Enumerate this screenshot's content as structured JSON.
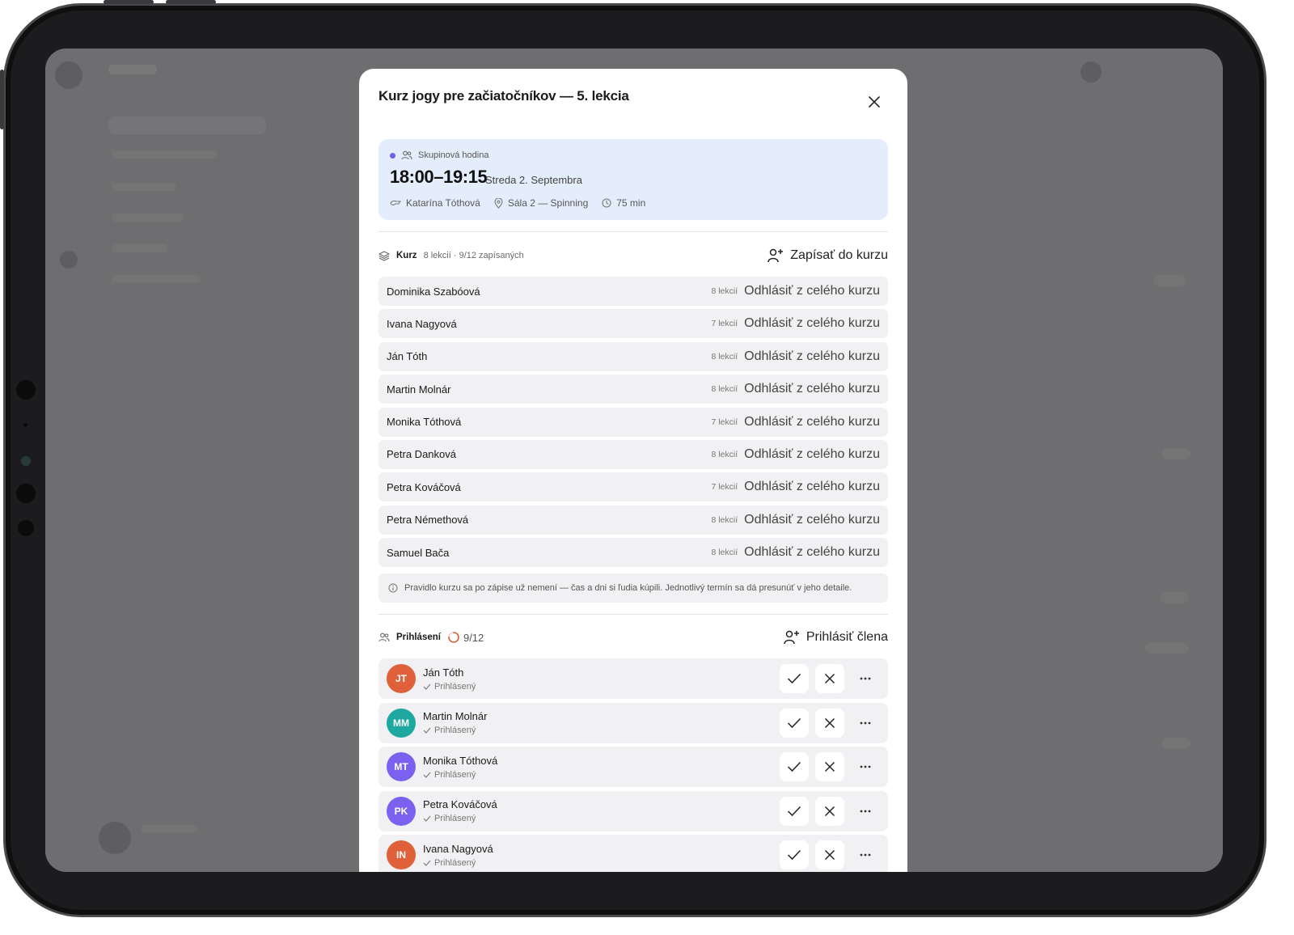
{
  "modal": {
    "title": "Kurz jogy pre začiatočníkov — 5. lekcia"
  },
  "event": {
    "type_label": "Skupinová hodina",
    "time": "18:00–19:15",
    "date": "Streda 2. Septembra",
    "instructor": "Katarína Tóthová",
    "room": "Sála 2 — Spinning",
    "duration": "75 min",
    "dot_color": "#6b63e8"
  },
  "course": {
    "label": "Kurz",
    "meta": "8 lekcií · 9/12 zapísaných",
    "enroll_label": "Zapísať do kurzu",
    "unenroll_label": "Odhlásiť z celého kurzu",
    "participants": [
      {
        "name": "Dominika Szabóová",
        "lessons": "8 lekcií"
      },
      {
        "name": "Ivana Nagyová",
        "lessons": "7 lekcií"
      },
      {
        "name": "Ján Tóth",
        "lessons": "8 lekcií"
      },
      {
        "name": "Martin Molnár",
        "lessons": "8 lekcií"
      },
      {
        "name": "Monika Tóthová",
        "lessons": "7 lekcií"
      },
      {
        "name": "Petra Danková",
        "lessons": "8 lekcií"
      },
      {
        "name": "Petra Kováčová",
        "lessons": "7 lekcií"
      },
      {
        "name": "Petra Némethová",
        "lessons": "8 lekcií"
      },
      {
        "name": "Samuel Bača",
        "lessons": "8 lekcií"
      }
    ],
    "note": "Pravidlo kurzu sa po zápise už nemení — čas a dni si ľudia kúpili. Jednotlivý termín sa dá presunúť v jeho detaile."
  },
  "signups": {
    "label": "Prihlásení",
    "count": "9/12",
    "progress": 0.75,
    "add_label": "Prihlásiť člena",
    "members": [
      {
        "initials": "JT",
        "name": "Ján Tóth",
        "status": "Prihlásený",
        "color": "#e0603a"
      },
      {
        "initials": "MM",
        "name": "Martin Molnár",
        "status": "Prihlásený",
        "color": "#1fa8a0"
      },
      {
        "initials": "MT",
        "name": "Monika Tóthová",
        "status": "Prihlásený",
        "color": "#7b61f0"
      },
      {
        "initials": "PK",
        "name": "Petra Kováčová",
        "status": "Prihlásený",
        "color": "#7b61f0"
      },
      {
        "initials": "IN",
        "name": "Ivana Nagyová",
        "status": "Prihlásený",
        "color": "#e0603a"
      }
    ]
  }
}
